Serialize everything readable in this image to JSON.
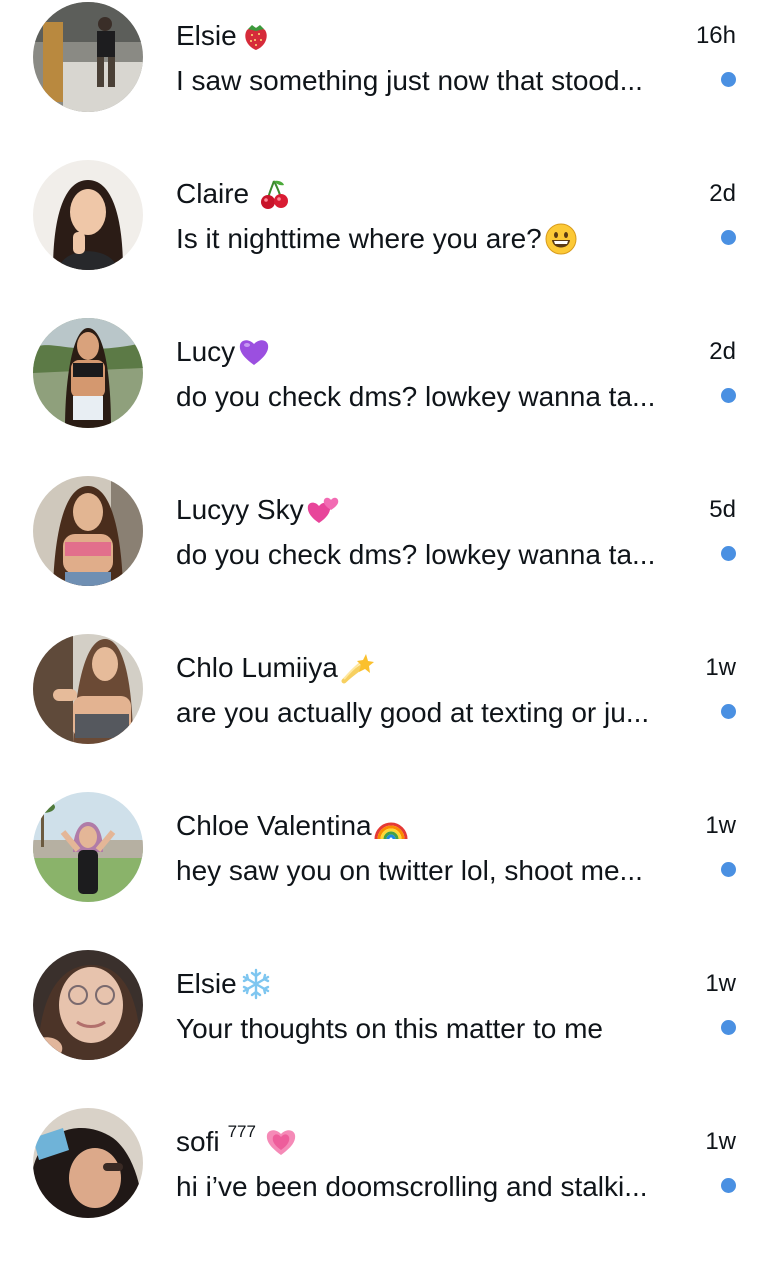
{
  "colors": {
    "unread_dot": "#4a90e2",
    "text": "#0f1419",
    "background": "#ffffff"
  },
  "conversations": [
    {
      "name": "Elsie",
      "name_emoji": "strawberry-icon",
      "name_sup": "",
      "time": "16h",
      "preview": "I saw something just now that stood...",
      "preview_emoji": "",
      "unread": true
    },
    {
      "name": "Claire",
      "name_emoji": "cherries-icon",
      "name_sup": "",
      "time": "2d",
      "preview": "Is it nighttime where you are?",
      "preview_emoji": "grinning-face-icon",
      "unread": true
    },
    {
      "name": "Lucy",
      "name_emoji": "purple-heart-icon",
      "name_sup": "",
      "time": "2d",
      "preview": "do you check dms? lowkey wanna ta...",
      "preview_emoji": "",
      "unread": true
    },
    {
      "name": "Lucyy Sky",
      "name_emoji": "two-hearts-icon",
      "name_sup": "",
      "time": "5d",
      "preview": "do you check dms? lowkey wanna ta...",
      "preview_emoji": "",
      "unread": true
    },
    {
      "name": "Chlo Lumiiya",
      "name_emoji": "shooting-star-icon",
      "name_sup": "",
      "time": "1w",
      "preview": "are you actually good at texting or ju...",
      "preview_emoji": "",
      "unread": true
    },
    {
      "name": "Chloe Valentina",
      "name_emoji": "rainbow-icon",
      "name_sup": "",
      "time": "1w",
      "preview": "hey saw you on twitter lol, shoot me...",
      "preview_emoji": "",
      "unread": true
    },
    {
      "name": "Elsie",
      "name_emoji": "snowflake-icon",
      "name_sup": "",
      "time": "1w",
      "preview": "Your thoughts on this matter to me",
      "preview_emoji": "",
      "unread": true
    },
    {
      "name": "sofi",
      "name_emoji": "pink-heart-icon",
      "name_sup": "777",
      "time": "1w",
      "preview": "hi i’ve been doomscrolling and stalki...",
      "preview_emoji": "",
      "unread": true
    }
  ]
}
